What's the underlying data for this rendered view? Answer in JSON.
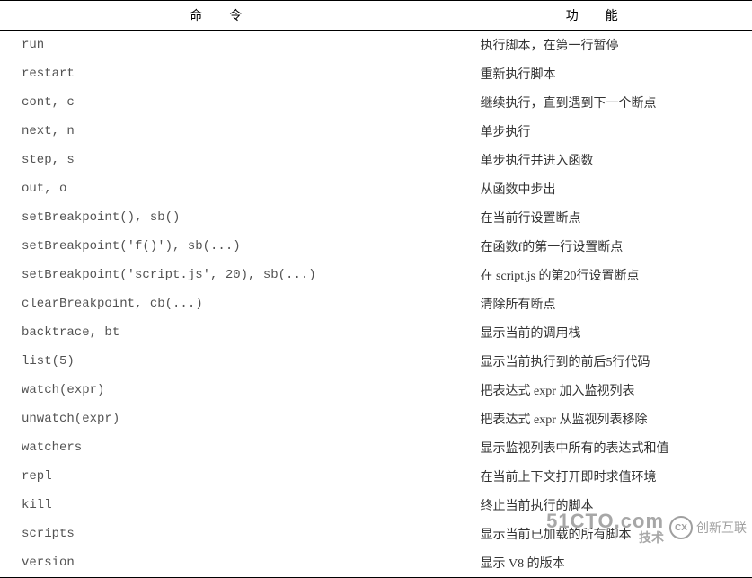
{
  "headers": {
    "command": "命令",
    "function": "功能"
  },
  "rows": [
    {
      "cmd": "run",
      "desc": "执行脚本，在第一行暂停"
    },
    {
      "cmd": "restart",
      "desc": "重新执行脚本"
    },
    {
      "cmd": "cont, c",
      "desc": "继续执行，直到遇到下一个断点"
    },
    {
      "cmd": "next, n",
      "desc": "单步执行"
    },
    {
      "cmd": "step, s",
      "desc": "单步执行并进入函数"
    },
    {
      "cmd": "out, o",
      "desc": "从函数中步出"
    },
    {
      "cmd": "setBreakpoint(), sb()",
      "desc": "在当前行设置断点"
    },
    {
      "cmd": "setBreakpoint('f()'), sb(...)",
      "desc": "在函数f的第一行设置断点"
    },
    {
      "cmd": "setBreakpoint('script.js', 20), sb(...)",
      "desc": "在 script.js 的第20行设置断点"
    },
    {
      "cmd": "clearBreakpoint, cb(...)",
      "desc": "清除所有断点"
    },
    {
      "cmd": "backtrace, bt",
      "desc": "显示当前的调用栈"
    },
    {
      "cmd": "list(5)",
      "desc": "显示当前执行到的前后5行代码"
    },
    {
      "cmd": "watch(expr)",
      "desc": "把表达式 expr 加入监视列表"
    },
    {
      "cmd": "unwatch(expr)",
      "desc": "把表达式 expr 从监视列表移除"
    },
    {
      "cmd": "watchers",
      "desc": "显示监视列表中所有的表达式和值"
    },
    {
      "cmd": "repl",
      "desc": "在当前上下文打开即时求值环境"
    },
    {
      "cmd": "kill",
      "desc": "终止当前执行的脚本"
    },
    {
      "cmd": "scripts",
      "desc": "显示当前已加载的所有脚本"
    },
    {
      "cmd": "version",
      "desc": "显示 V8 的版本"
    }
  ],
  "watermark": {
    "site_top": "51CTO.com",
    "site_bottom": "技术",
    "cx_logo": "CX",
    "cx_text": "创新互联"
  }
}
